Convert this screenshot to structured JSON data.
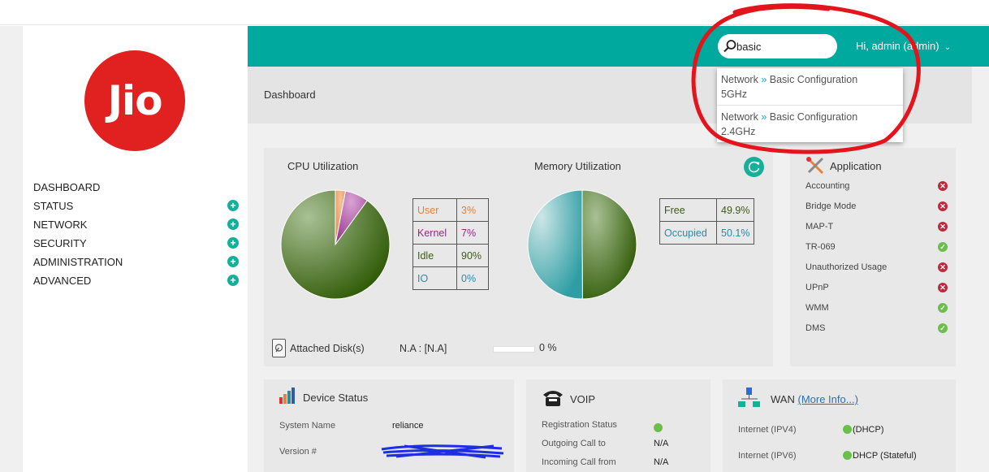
{
  "brand": {
    "logo_text": "Jio",
    "accent": "#00a99d",
    "logo_color": "#e1211f"
  },
  "sidebar": {
    "items": [
      {
        "label": "DASHBOARD",
        "expandable": false
      },
      {
        "label": "STATUS",
        "expandable": true
      },
      {
        "label": "NETWORK",
        "expandable": true
      },
      {
        "label": "SECURITY",
        "expandable": true
      },
      {
        "label": "ADMINISTRATION",
        "expandable": true
      },
      {
        "label": "ADVANCED",
        "expandable": true
      }
    ],
    "expand_icon": "+"
  },
  "header": {
    "search_value": "basic",
    "user_menu": "Hi, admin (admin)",
    "chevron": "⌄"
  },
  "breadcrumb": "Dashboard",
  "search_results": [
    {
      "section": "Network",
      "separator": "»",
      "page": "Basic Configuration",
      "band": "5GHz"
    },
    {
      "section": "Network",
      "separator": "»",
      "page": "Basic Configuration",
      "band": "2.4GHz"
    }
  ],
  "cpu": {
    "title": "CPU Utilization",
    "rows": [
      {
        "label": "User",
        "value": "3%",
        "color": "#e8823a"
      },
      {
        "label": "Kernel",
        "value": "7%",
        "color": "#8e2a86"
      },
      {
        "label": "Idle",
        "value": "90%",
        "color": "#3b5a17"
      },
      {
        "label": "IO",
        "value": "0%",
        "color": "#2a8aa8"
      }
    ]
  },
  "memory": {
    "title": "Memory Utilization",
    "rows": [
      {
        "label": "Free",
        "value": "49.9%",
        "color": "#3b5a17"
      },
      {
        "label": "Occupied",
        "value": "50.1%",
        "color": "#2a8aa8"
      }
    ]
  },
  "chart_data": [
    {
      "type": "pie",
      "title": "CPU Utilization",
      "categories": [
        "User",
        "Kernel",
        "Idle",
        "IO"
      ],
      "values": [
        3,
        7,
        90,
        0
      ],
      "colors": [
        "#f0a36c",
        "#b05aa8",
        "#5c8a2e",
        "#2a8aa8"
      ]
    },
    {
      "type": "pie",
      "title": "Memory Utilization",
      "categories": [
        "Free",
        "Occupied"
      ],
      "values": [
        49.9,
        50.1
      ],
      "colors": [
        "#5c8a2e",
        "#4fb1b5"
      ]
    }
  ],
  "disk": {
    "label": "Attached Disk(s)",
    "value": "N.A : [N.A]",
    "percent": "0 %",
    "usage_fraction": 0
  },
  "application": {
    "title": "Application",
    "items": [
      {
        "label": "Accounting",
        "status": "off"
      },
      {
        "label": "Bridge Mode",
        "status": "off"
      },
      {
        "label": "MAP-T",
        "status": "off"
      },
      {
        "label": "TR-069",
        "status": "on"
      },
      {
        "label": "Unauthorized Usage",
        "status": "off"
      },
      {
        "label": "UPnP",
        "status": "off"
      },
      {
        "label": "WMM",
        "status": "on"
      },
      {
        "label": "DMS",
        "status": "on"
      }
    ]
  },
  "device_status": {
    "title": "Device Status",
    "rows": [
      {
        "label": "System Name",
        "value": "reliance"
      },
      {
        "label": "Version #",
        "value": ""
      }
    ]
  },
  "voip": {
    "title": "VOIP",
    "rows": [
      {
        "label": "Registration Status",
        "value": ""
      },
      {
        "label": "Outgoing Call to",
        "value": "N/A"
      },
      {
        "label": "Incoming Call from",
        "value": "N/A"
      }
    ]
  },
  "wan": {
    "title": "WAN",
    "more_link": "(More Info...)",
    "rows": [
      {
        "label": "Internet (IPV4)",
        "value": "(DHCP)"
      },
      {
        "label": "Internet (IPV6)",
        "value": "DHCP (Stateful)"
      }
    ]
  }
}
